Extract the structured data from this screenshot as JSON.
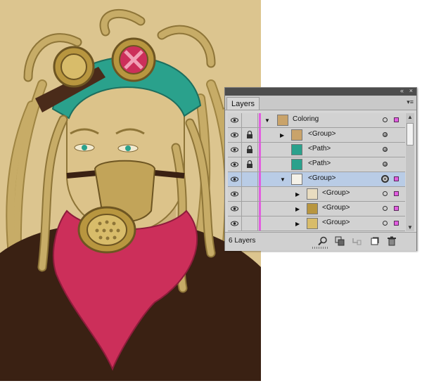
{
  "panel": {
    "tab_label": "Layers",
    "collapse_glyph": "«",
    "close_glyph": "×",
    "menu_glyph": "▾≡",
    "layer_count": "6 Layers"
  },
  "rows": [
    {
      "name": "Coloring",
      "selected": false,
      "locked": false
    },
    {
      "name": "<Group>",
      "selected": false,
      "locked": true
    },
    {
      "name": "<Path>",
      "selected": false,
      "locked": true
    },
    {
      "name": "<Path>",
      "selected": false,
      "locked": true
    },
    {
      "name": "<Group>",
      "selected": true,
      "locked": false
    },
    {
      "name": "<Group>",
      "selected": false,
      "locked": false
    },
    {
      "name": "<Group>",
      "selected": false,
      "locked": false
    },
    {
      "name": "<Group>",
      "selected": false,
      "locked": false
    }
  ],
  "footer_icons": [
    "search-icon",
    "clipping-mask-icon",
    "sublayer-icon",
    "new-layer-icon",
    "trash-icon"
  ],
  "colors": {
    "layer_color": "#e25de0",
    "selection": "#b9cce6",
    "artboard": "#dcc58f",
    "scarf": "#cc2f5a",
    "headband": "#2aa18c",
    "hair": "#c7ac67",
    "jacket": "#3a2113"
  }
}
